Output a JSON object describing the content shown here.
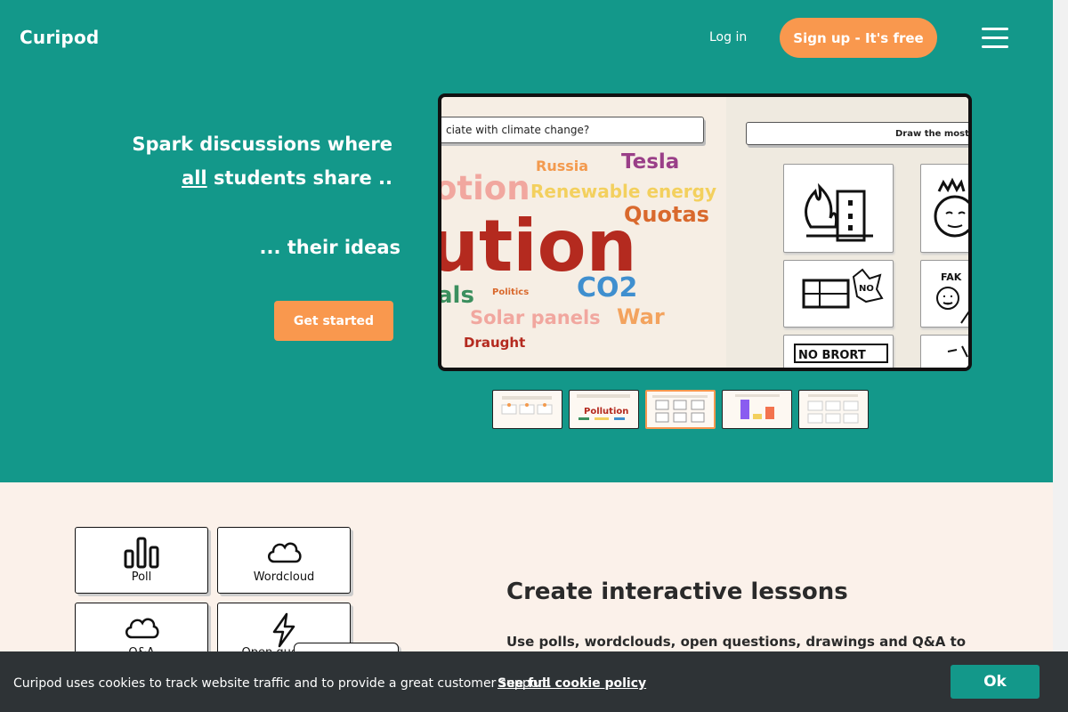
{
  "header": {
    "logo": "Curipod",
    "login_label": "Log in",
    "signup_label": "Sign up - It's free"
  },
  "hero": {
    "line1": "Spark discussions where",
    "line2_underlined": "all",
    "line2_rest": " students share ..",
    "line3": "... their ideas",
    "cta_label": "Get started",
    "slide_left_question": "ciate with climate change?",
    "slide_right_question": "Draw the most i",
    "words": [
      "Russia",
      "Tesla",
      "otion",
      "Renewable energy",
      "Quotas",
      "ution",
      "CO2",
      "als",
      "Politics",
      "Solar panels",
      "War",
      "Draught"
    ],
    "drawing_caption": "NO BRORT"
  },
  "thumbnails": {
    "thumb2_word": "Pollution"
  },
  "features": {
    "cards": [
      {
        "label": "Poll",
        "icon": "bar-chart-icon"
      },
      {
        "label": "Wordcloud",
        "icon": "cloud-icon"
      },
      {
        "label": "Q&A",
        "icon": "cloud-icon"
      },
      {
        "label": "Open question",
        "icon": "lightning-icon"
      }
    ],
    "title": "Create interactive lessons",
    "text": "Use polls, wordclouds, open questions, drawings and Q&A to"
  },
  "cookie": {
    "text": "Curipod uses cookies to track website traffic and to provide a great customer support.",
    "link": "See full cookie policy",
    "ok_label": "Ok"
  },
  "colors": {
    "primary": "#13988a",
    "accent": "#f9984e",
    "cream": "#fbf1ea",
    "cookie_bar": "#2e3336"
  }
}
